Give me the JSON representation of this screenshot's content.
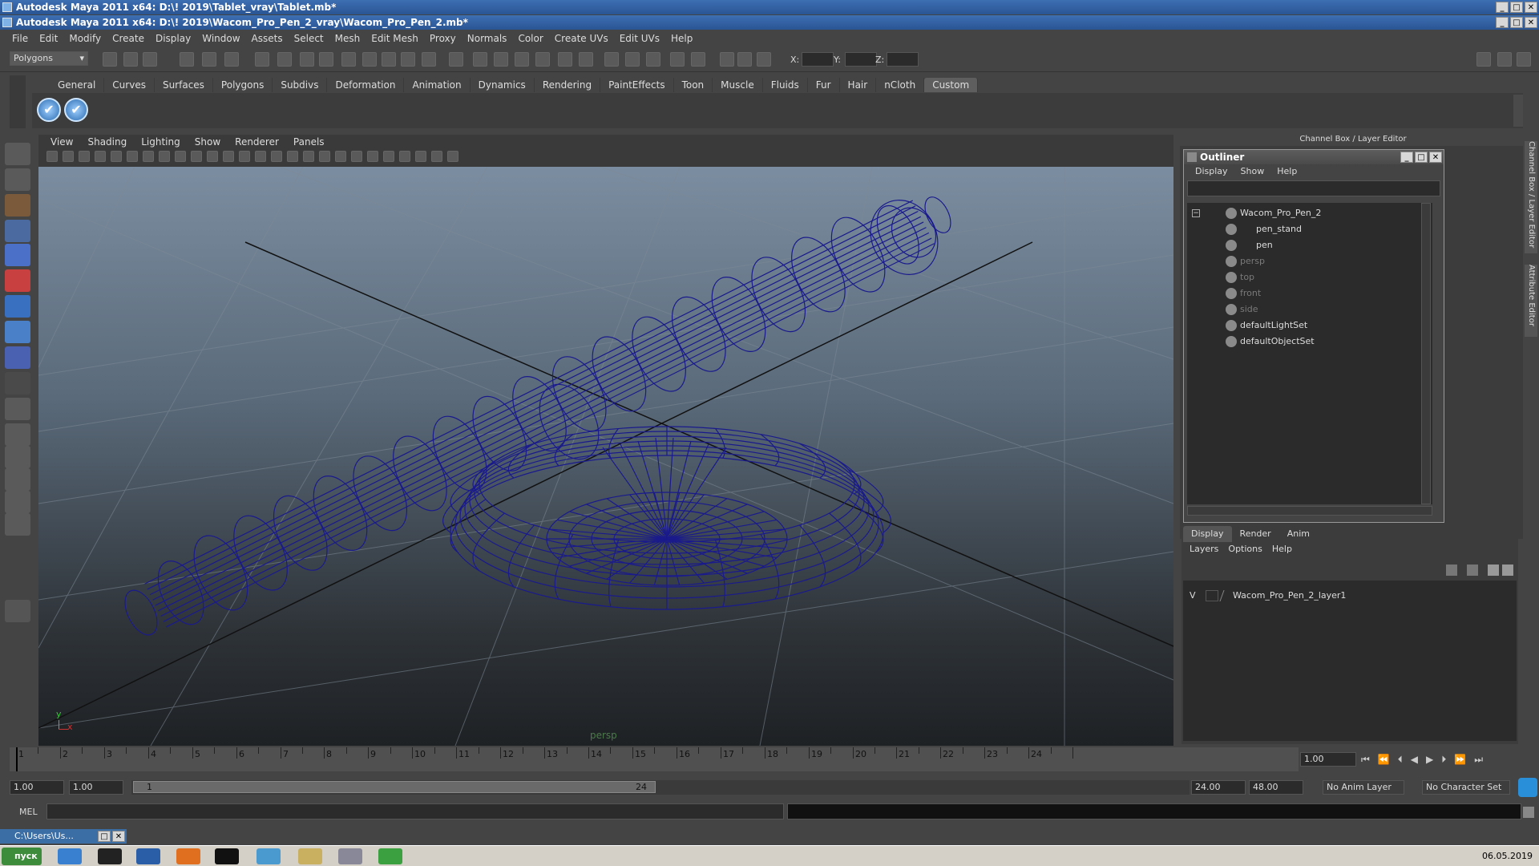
{
  "window_titles": {
    "back": "Autodesk Maya 2011 x64: D:\\! 2019\\Tablet_vray\\Tablet.mb*",
    "front": "Autodesk Maya 2011 x64: D:\\! 2019\\Wacom_Pro_Pen_2_vray\\Wacom_Pro_Pen_2.mb*"
  },
  "menubar": [
    "File",
    "Edit",
    "Modify",
    "Create",
    "Display",
    "Window",
    "Assets",
    "Select",
    "Mesh",
    "Edit Mesh",
    "Proxy",
    "Normals",
    "Color",
    "Create UVs",
    "Edit UVs",
    "Help"
  ],
  "toolbar": {
    "mode_select": "Polygons",
    "x_label": "X:",
    "y_label": "Y:",
    "z_label": "Z:"
  },
  "shelf_tabs": [
    "General",
    "Curves",
    "Surfaces",
    "Polygons",
    "Subdivs",
    "Deformation",
    "Animation",
    "Dynamics",
    "Rendering",
    "PaintEffects",
    "Toon",
    "Muscle",
    "Fluids",
    "Fur",
    "Hair",
    "nCloth",
    "Custom"
  ],
  "shelf_active": "Custom",
  "viewport": {
    "menu": [
      "View",
      "Shading",
      "Lighting",
      "Show",
      "Renderer",
      "Panels"
    ],
    "camera_label": "persp",
    "axis_y": "y",
    "axis_x": "x",
    "wire_color": "#1a1a8c"
  },
  "channel_box_title": "Channel Box / Layer Editor",
  "outliner": {
    "title": "Outliner",
    "menu": [
      "Display",
      "Show",
      "Help"
    ],
    "items": [
      {
        "label": "Wacom_Pro_Pen_2",
        "dim": false
      },
      {
        "label": "pen_stand",
        "dim": false
      },
      {
        "label": "pen",
        "dim": false
      },
      {
        "label": "persp",
        "dim": true
      },
      {
        "label": "top",
        "dim": true
      },
      {
        "label": "front",
        "dim": true
      },
      {
        "label": "side",
        "dim": true
      },
      {
        "label": "defaultLightSet",
        "dim": false
      },
      {
        "label": "defaultObjectSet",
        "dim": false
      }
    ]
  },
  "layer_editor": {
    "tabs": [
      "Display",
      "Render",
      "Anim"
    ],
    "active_tab": "Display",
    "menu": [
      "Layers",
      "Options",
      "Help"
    ],
    "layer_visible": "V",
    "layer_name": "Wacom_Pro_Pen_2_layer1"
  },
  "side_tabs": [
    "Channel Box / Layer Editor",
    "Attribute Editor"
  ],
  "timeline": {
    "ticks": [
      "1",
      "2",
      "3",
      "4",
      "5",
      "6",
      "7",
      "8",
      "9",
      "10",
      "11",
      "12",
      "13",
      "14",
      "15",
      "16",
      "17",
      "18",
      "19",
      "20",
      "21",
      "22",
      "23",
      "24"
    ],
    "current_frame": "1.00"
  },
  "range": {
    "start": "1.00",
    "start2": "1.00",
    "slider_start": "1",
    "slider_end": "24",
    "end": "24.00",
    "end2": "48.00",
    "anim_layer": "No Anim Layer",
    "char_set": "No Character Set"
  },
  "cmdline": {
    "label": "MEL"
  },
  "taskbar": {
    "minimized": "C:\\Users\\Us...",
    "start_label": "пуск",
    "clock": "06.05.2019"
  }
}
